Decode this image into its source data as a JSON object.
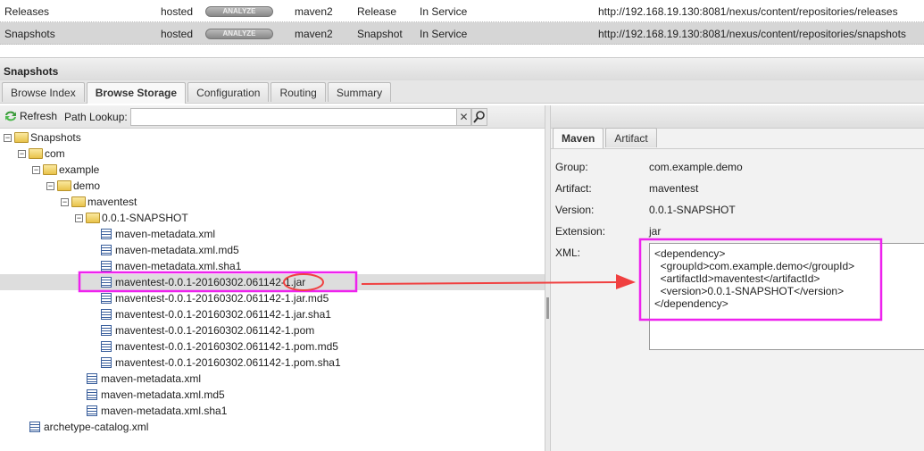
{
  "repositories": [
    {
      "name": "Releases",
      "type": "hosted",
      "analyze": "ANALYZE",
      "format": "maven2",
      "policy": "Release",
      "status": "In Service",
      "url": "http://192.168.19.130:8081/nexus/content/repositories/releases",
      "selected": false
    },
    {
      "name": "Snapshots",
      "type": "hosted",
      "analyze": "ANALYZE",
      "format": "maven2",
      "policy": "Snapshot",
      "status": "In Service",
      "url": "http://192.168.19.130:8081/nexus/content/repositories/snapshots",
      "selected": true
    }
  ],
  "panel": {
    "title": "Snapshots",
    "tabs": [
      "Browse Index",
      "Browse Storage",
      "Configuration",
      "Routing",
      "Summary"
    ],
    "active_tab": "Browse Storage"
  },
  "toolbar": {
    "refresh": "Refresh",
    "path_lookup_label": "Path Lookup:",
    "path_lookup_value": ""
  },
  "tree": [
    {
      "label": "Snapshots",
      "level": 0,
      "kind": "folder"
    },
    {
      "label": "com",
      "level": 1,
      "kind": "folder"
    },
    {
      "label": "example",
      "level": 2,
      "kind": "folder"
    },
    {
      "label": "demo",
      "level": 3,
      "kind": "folder"
    },
    {
      "label": "maventest",
      "level": 4,
      "kind": "folder"
    },
    {
      "label": "0.0.1-SNAPSHOT",
      "level": 5,
      "kind": "folder"
    },
    {
      "label": "maven-metadata.xml",
      "level": 6,
      "kind": "file"
    },
    {
      "label": "maven-metadata.xml.md5",
      "level": 6,
      "kind": "file"
    },
    {
      "label": "maven-metadata.xml.sha1",
      "level": 6,
      "kind": "file"
    },
    {
      "label": "maventest-0.0.1-20160302.061142-1.jar",
      "level": 6,
      "kind": "file",
      "selected": true
    },
    {
      "label": "maventest-0.0.1-20160302.061142-1.jar.md5",
      "level": 6,
      "kind": "file"
    },
    {
      "label": "maventest-0.0.1-20160302.061142-1.jar.sha1",
      "level": 6,
      "kind": "file"
    },
    {
      "label": "maventest-0.0.1-20160302.061142-1.pom",
      "level": 6,
      "kind": "file"
    },
    {
      "label": "maventest-0.0.1-20160302.061142-1.pom.md5",
      "level": 6,
      "kind": "file"
    },
    {
      "label": "maventest-0.0.1-20160302.061142-1.pom.sha1",
      "level": 6,
      "kind": "file"
    },
    {
      "label": "maven-metadata.xml",
      "level": 5,
      "kind": "file"
    },
    {
      "label": "maven-metadata.xml.md5",
      "level": 5,
      "kind": "file"
    },
    {
      "label": "maven-metadata.xml.sha1",
      "level": 5,
      "kind": "file"
    },
    {
      "label": "archetype-catalog.xml",
      "level": 1,
      "kind": "file"
    }
  ],
  "details": {
    "tabs": [
      "Maven",
      "Artifact"
    ],
    "active_tab": "Maven",
    "fields": [
      {
        "label": "Group:",
        "value": "com.example.demo"
      },
      {
        "label": "Artifact:",
        "value": "maventest"
      },
      {
        "label": "Version:",
        "value": "0.0.1-SNAPSHOT"
      },
      {
        "label": "Extension:",
        "value": "jar"
      }
    ],
    "xml_label": "XML:",
    "xml": "<dependency>\n  <groupId>com.example.demo</groupId>\n  <artifactId>maventest</artifactId>\n  <version>0.0.1-SNAPSHOT</version>\n</dependency>"
  },
  "colors": {
    "highlight_box": "#ee22ee",
    "annotation_red": "#f04040",
    "selected_row": "#dddddd"
  }
}
